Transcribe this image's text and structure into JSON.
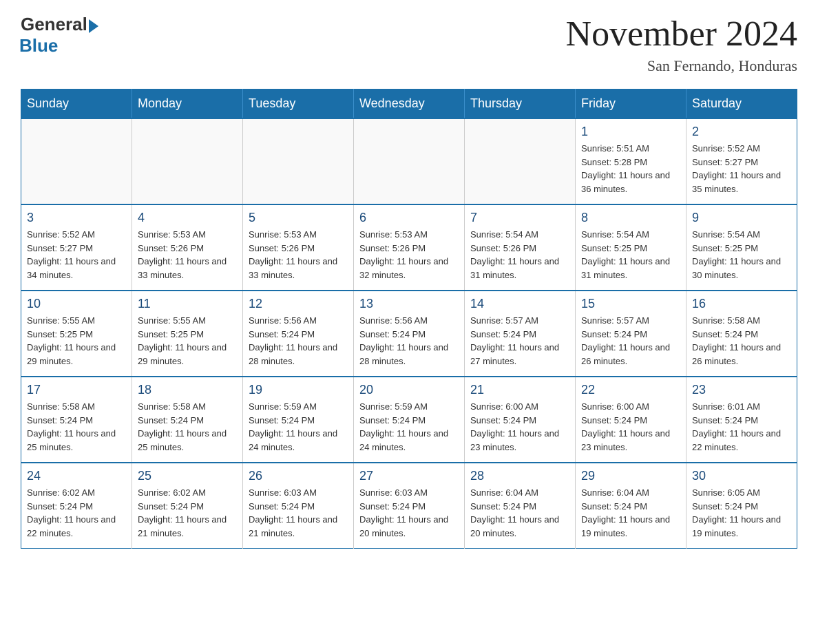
{
  "header": {
    "logo": {
      "general_text": "General",
      "blue_text": "Blue"
    },
    "title": "November 2024",
    "location": "San Fernando, Honduras"
  },
  "calendar": {
    "days_of_week": [
      "Sunday",
      "Monday",
      "Tuesday",
      "Wednesday",
      "Thursday",
      "Friday",
      "Saturday"
    ],
    "weeks": [
      {
        "days": [
          {
            "number": "",
            "info": "",
            "empty": true
          },
          {
            "number": "",
            "info": "",
            "empty": true
          },
          {
            "number": "",
            "info": "",
            "empty": true
          },
          {
            "number": "",
            "info": "",
            "empty": true
          },
          {
            "number": "",
            "info": "",
            "empty": true
          },
          {
            "number": "1",
            "info": "Sunrise: 5:51 AM\nSunset: 5:28 PM\nDaylight: 11 hours and 36 minutes.",
            "empty": false
          },
          {
            "number": "2",
            "info": "Sunrise: 5:52 AM\nSunset: 5:27 PM\nDaylight: 11 hours and 35 minutes.",
            "empty": false
          }
        ]
      },
      {
        "days": [
          {
            "number": "3",
            "info": "Sunrise: 5:52 AM\nSunset: 5:27 PM\nDaylight: 11 hours and 34 minutes.",
            "empty": false
          },
          {
            "number": "4",
            "info": "Sunrise: 5:53 AM\nSunset: 5:26 PM\nDaylight: 11 hours and 33 minutes.",
            "empty": false
          },
          {
            "number": "5",
            "info": "Sunrise: 5:53 AM\nSunset: 5:26 PM\nDaylight: 11 hours and 33 minutes.",
            "empty": false
          },
          {
            "number": "6",
            "info": "Sunrise: 5:53 AM\nSunset: 5:26 PM\nDaylight: 11 hours and 32 minutes.",
            "empty": false
          },
          {
            "number": "7",
            "info": "Sunrise: 5:54 AM\nSunset: 5:26 PM\nDaylight: 11 hours and 31 minutes.",
            "empty": false
          },
          {
            "number": "8",
            "info": "Sunrise: 5:54 AM\nSunset: 5:25 PM\nDaylight: 11 hours and 31 minutes.",
            "empty": false
          },
          {
            "number": "9",
            "info": "Sunrise: 5:54 AM\nSunset: 5:25 PM\nDaylight: 11 hours and 30 minutes.",
            "empty": false
          }
        ]
      },
      {
        "days": [
          {
            "number": "10",
            "info": "Sunrise: 5:55 AM\nSunset: 5:25 PM\nDaylight: 11 hours and 29 minutes.",
            "empty": false
          },
          {
            "number": "11",
            "info": "Sunrise: 5:55 AM\nSunset: 5:25 PM\nDaylight: 11 hours and 29 minutes.",
            "empty": false
          },
          {
            "number": "12",
            "info": "Sunrise: 5:56 AM\nSunset: 5:24 PM\nDaylight: 11 hours and 28 minutes.",
            "empty": false
          },
          {
            "number": "13",
            "info": "Sunrise: 5:56 AM\nSunset: 5:24 PM\nDaylight: 11 hours and 28 minutes.",
            "empty": false
          },
          {
            "number": "14",
            "info": "Sunrise: 5:57 AM\nSunset: 5:24 PM\nDaylight: 11 hours and 27 minutes.",
            "empty": false
          },
          {
            "number": "15",
            "info": "Sunrise: 5:57 AM\nSunset: 5:24 PM\nDaylight: 11 hours and 26 minutes.",
            "empty": false
          },
          {
            "number": "16",
            "info": "Sunrise: 5:58 AM\nSunset: 5:24 PM\nDaylight: 11 hours and 26 minutes.",
            "empty": false
          }
        ]
      },
      {
        "days": [
          {
            "number": "17",
            "info": "Sunrise: 5:58 AM\nSunset: 5:24 PM\nDaylight: 11 hours and 25 minutes.",
            "empty": false
          },
          {
            "number": "18",
            "info": "Sunrise: 5:58 AM\nSunset: 5:24 PM\nDaylight: 11 hours and 25 minutes.",
            "empty": false
          },
          {
            "number": "19",
            "info": "Sunrise: 5:59 AM\nSunset: 5:24 PM\nDaylight: 11 hours and 24 minutes.",
            "empty": false
          },
          {
            "number": "20",
            "info": "Sunrise: 5:59 AM\nSunset: 5:24 PM\nDaylight: 11 hours and 24 minutes.",
            "empty": false
          },
          {
            "number": "21",
            "info": "Sunrise: 6:00 AM\nSunset: 5:24 PM\nDaylight: 11 hours and 23 minutes.",
            "empty": false
          },
          {
            "number": "22",
            "info": "Sunrise: 6:00 AM\nSunset: 5:24 PM\nDaylight: 11 hours and 23 minutes.",
            "empty": false
          },
          {
            "number": "23",
            "info": "Sunrise: 6:01 AM\nSunset: 5:24 PM\nDaylight: 11 hours and 22 minutes.",
            "empty": false
          }
        ]
      },
      {
        "days": [
          {
            "number": "24",
            "info": "Sunrise: 6:02 AM\nSunset: 5:24 PM\nDaylight: 11 hours and 22 minutes.",
            "empty": false
          },
          {
            "number": "25",
            "info": "Sunrise: 6:02 AM\nSunset: 5:24 PM\nDaylight: 11 hours and 21 minutes.",
            "empty": false
          },
          {
            "number": "26",
            "info": "Sunrise: 6:03 AM\nSunset: 5:24 PM\nDaylight: 11 hours and 21 minutes.",
            "empty": false
          },
          {
            "number": "27",
            "info": "Sunrise: 6:03 AM\nSunset: 5:24 PM\nDaylight: 11 hours and 20 minutes.",
            "empty": false
          },
          {
            "number": "28",
            "info": "Sunrise: 6:04 AM\nSunset: 5:24 PM\nDaylight: 11 hours and 20 minutes.",
            "empty": false
          },
          {
            "number": "29",
            "info": "Sunrise: 6:04 AM\nSunset: 5:24 PM\nDaylight: 11 hours and 19 minutes.",
            "empty": false
          },
          {
            "number": "30",
            "info": "Sunrise: 6:05 AM\nSunset: 5:24 PM\nDaylight: 11 hours and 19 minutes.",
            "empty": false
          }
        ]
      }
    ]
  }
}
